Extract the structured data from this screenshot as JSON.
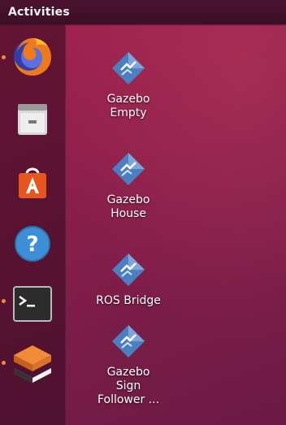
{
  "topbar": {
    "activities_label": "Activities"
  },
  "dock": {
    "items": [
      {
        "name": "Firefox",
        "icon": "firefox-icon",
        "running": true
      },
      {
        "name": "Files",
        "icon": "file-cabinet-icon",
        "running": false
      },
      {
        "name": "Ubuntu Software",
        "icon": "shopping-bag-icon",
        "running": false
      },
      {
        "name": "Help",
        "icon": "question-mark-icon",
        "running": false
      },
      {
        "name": "Terminal",
        "icon": "terminal-icon",
        "running": true
      },
      {
        "name": "Gazebo",
        "icon": "gazebo-box-icon",
        "running": true
      }
    ]
  },
  "desktop": {
    "icons": [
      {
        "label": "Gazebo\nEmpty",
        "icon": "launcher-diamond-icon"
      },
      {
        "label": "Gazebo\nHouse",
        "icon": "launcher-diamond-icon"
      },
      {
        "label": "ROS Bridge",
        "icon": "launcher-diamond-icon"
      },
      {
        "label": "Gazebo\nSign\nFollower ...",
        "icon": "launcher-diamond-icon"
      }
    ]
  },
  "colors": {
    "background": "#8c1f4b",
    "topbar": "#3a0f27",
    "running_indicator": "#f28a38",
    "launcher_icon": "#4a7fc1"
  }
}
